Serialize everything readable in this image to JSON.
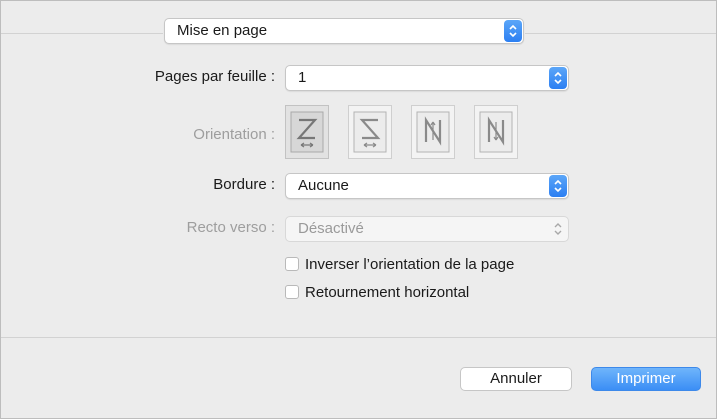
{
  "section_popup": {
    "value": "Mise en page"
  },
  "pages_per_sheet": {
    "label": "Pages par feuille :",
    "value": "1"
  },
  "orientation": {
    "label": "Orientation :",
    "options": [
      "Z",
      "S (inversé)",
      "N (inversé)",
      "N"
    ]
  },
  "border": {
    "label": "Bordure :",
    "value": "Aucune"
  },
  "duplex": {
    "label": "Recto verso :",
    "value": "Désactivé"
  },
  "options": [
    {
      "label": "Inverser l’orientation de la page",
      "checked": false
    },
    {
      "label": "Retournement horizontal",
      "checked": false
    }
  ],
  "buttons": {
    "cancel": "Annuler",
    "print": "Imprimer"
  },
  "colors": {
    "accent": "#2c7ff2",
    "print_button": "#4f9cf7"
  }
}
